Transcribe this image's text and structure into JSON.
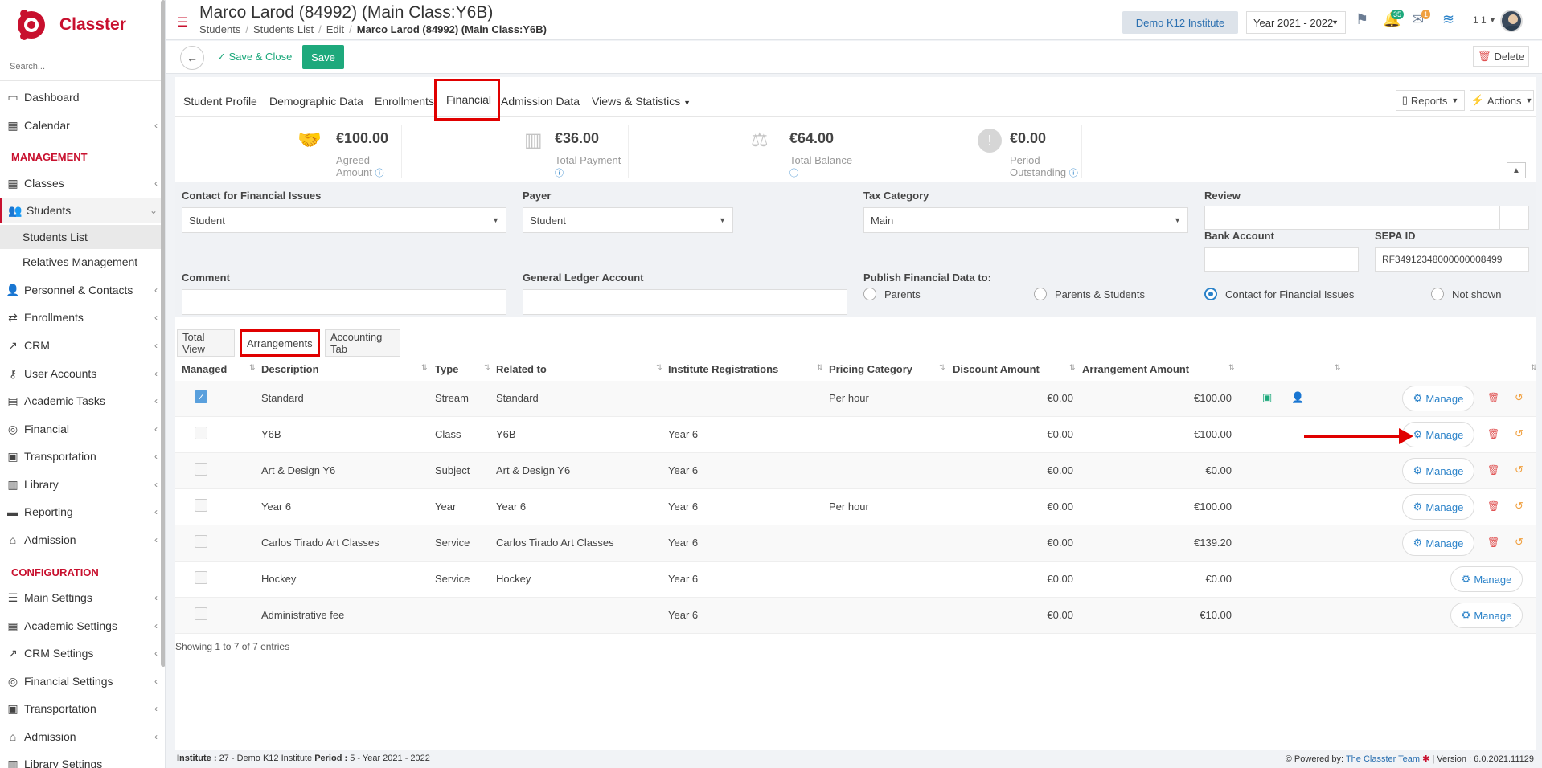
{
  "app": {
    "name": "Classter",
    "search_placeholder": "Search...",
    "brand_color": "#c8102e",
    "accent_color": "#1ea97c",
    "link_color": "#2a82c9"
  },
  "sidebar": {
    "items": [
      {
        "label": "Dashboard",
        "icon": "laptop-icon"
      },
      {
        "label": "Calendar",
        "icon": "calendar-icon"
      },
      {
        "label": "Classes",
        "icon": "grid-icon"
      },
      {
        "label": "Students",
        "icon": "users-icon"
      },
      {
        "label": "Personnel & Contacts",
        "icon": "person-icon"
      },
      {
        "label": "Enrollments",
        "icon": "exchange-icon"
      },
      {
        "label": "CRM",
        "icon": "crm-icon"
      },
      {
        "label": "User Accounts",
        "icon": "key-icon"
      },
      {
        "label": "Academic Tasks",
        "icon": "tasks-icon"
      },
      {
        "label": "Financial",
        "icon": "coins-icon"
      },
      {
        "label": "Transportation",
        "icon": "bus-icon"
      },
      {
        "label": "Library",
        "icon": "library-icon"
      },
      {
        "label": "Reporting",
        "icon": "print-icon"
      },
      {
        "label": "Admission",
        "icon": "bank-icon"
      },
      {
        "label": "Main Settings",
        "icon": "sliders-icon"
      },
      {
        "label": "Academic Settings",
        "icon": "grid-icon"
      },
      {
        "label": "CRM Settings",
        "icon": "crm-icon"
      },
      {
        "label": "Financial Settings",
        "icon": "coins-icon"
      },
      {
        "label": "Transportation",
        "icon": "bus-icon"
      },
      {
        "label": "Admission",
        "icon": "bank-icon"
      },
      {
        "label": "Library Settings",
        "icon": "library-icon"
      }
    ],
    "headings": {
      "management": "MANAGEMENT",
      "configuration": "CONFIGURATION"
    },
    "sub_items": {
      "students_list": "Students List",
      "relatives": "Relatives Management"
    }
  },
  "header": {
    "title": "Marco Larod (84992) (Main Class:Y6B)",
    "breadcrumb": [
      "Students",
      "Students List",
      "Edit",
      "Marco Larod (84992) (Main Class:Y6B)"
    ],
    "institute": "Demo K12 Institute",
    "year": "Year 2021 - 2022",
    "notif_count": "35",
    "mail_count": "1",
    "user_counter": "1 1"
  },
  "actionbar": {
    "save_close": "Save & Close",
    "save": "Save",
    "delete": "Delete"
  },
  "tabs": [
    "Student Profile",
    "Demographic Data",
    "Enrollments",
    "Financial",
    "Admission Data",
    "Views & Statistics"
  ],
  "active_tab": "Financial",
  "reports_label": "Reports",
  "actions_label": "Actions",
  "stats": [
    {
      "value": "€100.00",
      "label": "Agreed Amount",
      "icon": "handshake-icon"
    },
    {
      "value": "€36.00",
      "label": "Total Payment",
      "icon": "bar-chart-icon"
    },
    {
      "value": "€64.00",
      "label": "Total Balance",
      "icon": "balance-scale-icon"
    },
    {
      "value": "€0.00",
      "label": "Period Outstanding",
      "icon": "exclamation-icon"
    }
  ],
  "form": {
    "contact_label": "Contact for Financial Issues",
    "contact_value": "Student",
    "payer_label": "Payer",
    "payer_value": "Student",
    "tax_label": "Tax Category",
    "tax_value": "Main",
    "review_label": "Review",
    "review_value": "",
    "bank_label": "Bank Account",
    "bank_value": "",
    "sepa_label": "SEPA ID",
    "sepa_value": "RF34912348000000008499",
    "comment_label": "Comment",
    "comment_value": "",
    "gl_label": "General Ledger Account",
    "gl_value": "",
    "publish_label": "Publish Financial Data to:",
    "publish_options": [
      "Parents",
      "Parents & Students",
      "Contact for Financial Issues",
      "Not shown"
    ],
    "publish_selected": "Contact for Financial Issues"
  },
  "subtabs": [
    "Total View",
    "Arrangements",
    "Accounting Tab"
  ],
  "active_subtab": "Arrangements",
  "table": {
    "columns": [
      "Managed",
      "Description",
      "Type",
      "Related to",
      "Institute Registrations",
      "Pricing Category",
      "Discount Amount",
      "Arrangement Amount"
    ],
    "manage_label": "Manage",
    "rows": [
      {
        "managed": true,
        "description": "Standard",
        "type": "Stream",
        "related": "Standard",
        "registrations": "",
        "pricing": "Per hour",
        "discount": "€0.00",
        "amount": "€100.00"
      },
      {
        "managed": false,
        "description": "Y6B",
        "type": "Class",
        "related": "Y6B",
        "registrations": "Year 6",
        "pricing": "",
        "discount": "€0.00",
        "amount": "€100.00"
      },
      {
        "managed": false,
        "description": "Art & Design Y6",
        "type": "Subject",
        "related": "Art & Design Y6",
        "registrations": "Year 6",
        "pricing": "",
        "discount": "€0.00",
        "amount": "€0.00"
      },
      {
        "managed": false,
        "description": "Year 6",
        "type": "Year",
        "related": "Year 6",
        "registrations": "Year 6",
        "pricing": "Per hour",
        "discount": "€0.00",
        "amount": "€100.00"
      },
      {
        "managed": false,
        "description": "Carlos Tirado Art Classes",
        "type": "Service",
        "related": "Carlos Tirado Art Classes",
        "registrations": "Year 6",
        "pricing": "",
        "discount": "€0.00",
        "amount": "€139.20"
      },
      {
        "managed": false,
        "description": "Hockey",
        "type": "Service",
        "related": "Hockey",
        "registrations": "Year 6",
        "pricing": "",
        "discount": "€0.00",
        "amount": "€0.00"
      },
      {
        "managed": false,
        "description": "Administrative fee",
        "type": "",
        "related": "",
        "registrations": "Year 6",
        "pricing": "",
        "discount": "€0.00",
        "amount": "€10.00"
      }
    ],
    "showing": "Showing 1 to 7 of 7 entries"
  },
  "footer": {
    "institute_label": "Institute :",
    "institute_value": "27 - Demo K12 Institute",
    "period_label": "Period :",
    "period_value": "5 - Year 2021 - 2022",
    "powered_by": "Powered by:",
    "team": "The Classter Team",
    "version": "| Version : 6.0.2021.11129"
  }
}
